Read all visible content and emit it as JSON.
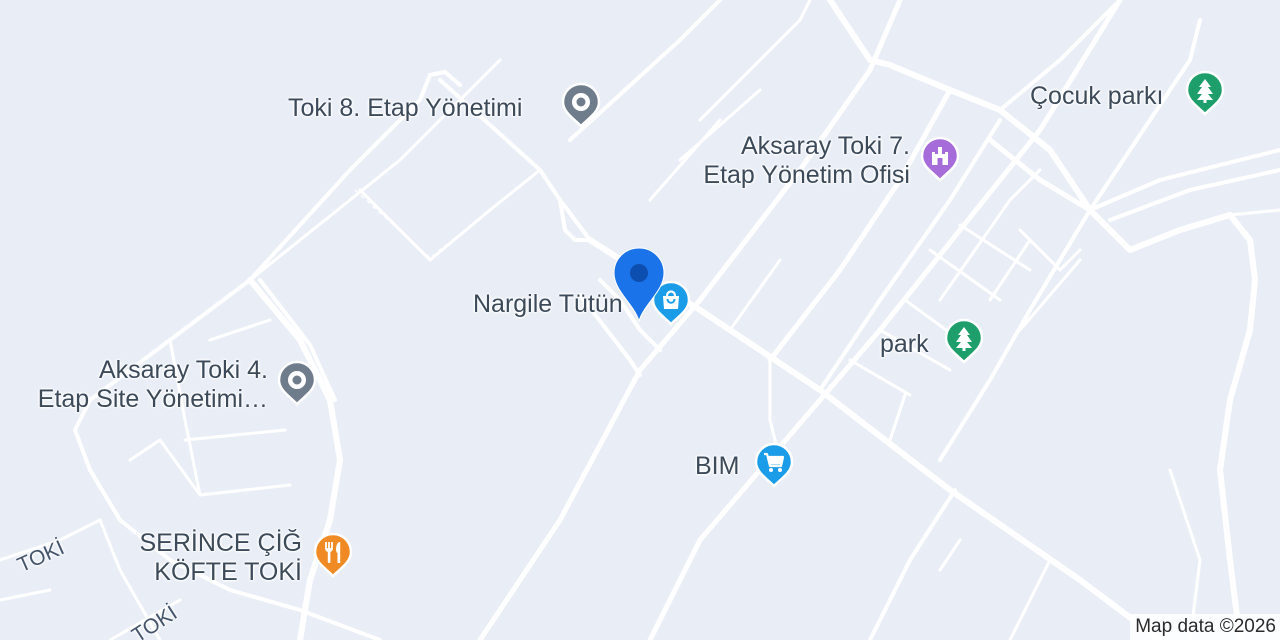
{
  "map": {
    "pois": [
      {
        "id": "toki8",
        "name": "Toki 8. Etap Yönetimi",
        "category": "generic",
        "icon": "pin-dot-icon",
        "color": "#6f7c8c"
      },
      {
        "id": "toki7",
        "line1": "Aksaray Toki 7.",
        "line2": "Etap Yönetim Ofisi",
        "category": "government",
        "icon": "building-icon",
        "color": "#a66cd9"
      },
      {
        "id": "cocuk",
        "name": "Çocuk parkı",
        "category": "park",
        "icon": "tree-icon",
        "color": "#1e9e6a"
      },
      {
        "id": "nargile",
        "name": "Nargile Tütün",
        "category": "shopping",
        "icon": "shopping-bag-icon",
        "color": "#1a9ce8"
      },
      {
        "id": "park",
        "name": "park",
        "category": "park",
        "icon": "tree-icon",
        "color": "#1e9e6a"
      },
      {
        "id": "toki4",
        "line1": "Aksaray Toki 4.",
        "line2": "Etap Site Yönetimi…",
        "category": "generic",
        "icon": "pin-dot-icon",
        "color": "#6f7c8c"
      },
      {
        "id": "bim",
        "name": "BIM",
        "category": "shopping",
        "icon": "shopping-cart-icon",
        "color": "#1a9ce8"
      },
      {
        "id": "serince",
        "line1": "SERİNCE ÇİĞ",
        "line2": "KÖFTE TOKİ",
        "category": "restaurant",
        "icon": "fork-knife-icon",
        "color": "#f08a24"
      }
    ],
    "road_labels": {
      "toki_a": "TOKİ",
      "toki_b": "TOKİ"
    },
    "selected_marker": {
      "icon": "location-marker-icon",
      "color": "#1a73e8"
    },
    "attribution": "Map data ©2026"
  }
}
